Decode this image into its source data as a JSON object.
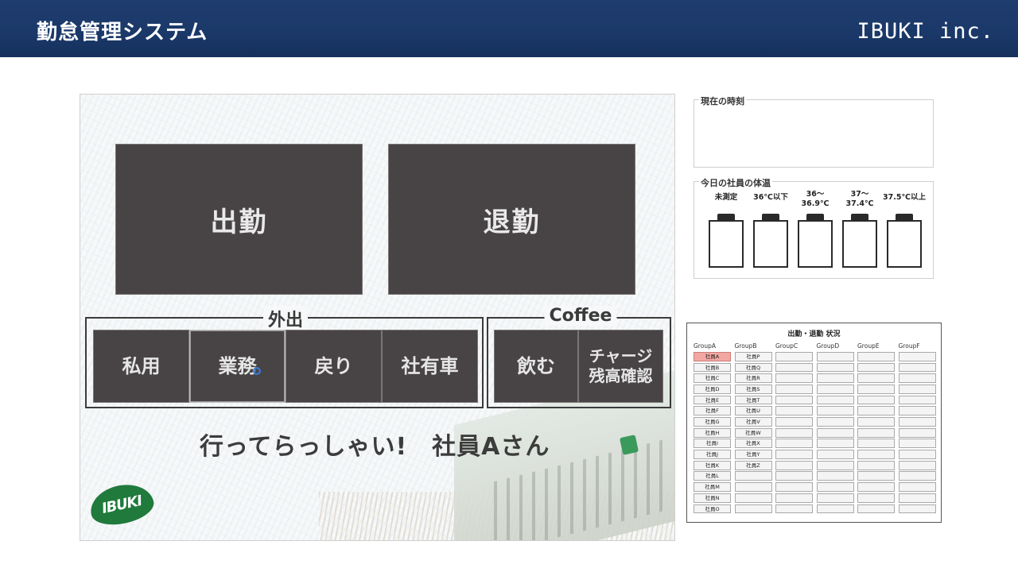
{
  "header": {
    "title": "勤怠管理システム",
    "company": "IBUKI inc."
  },
  "kiosk": {
    "clock_in_label": "出勤",
    "clock_out_label": "退勤",
    "outing": {
      "title": "外出",
      "buttons": [
        "私用",
        "業務",
        "戻り",
        "社有車"
      ]
    },
    "coffee": {
      "title": "Coffee",
      "drink_label": "飲む",
      "charge_label_line1": "チャージ",
      "charge_label_line2": "残高確認"
    },
    "greeting": "行ってらっしゃい!　社員Aさん",
    "logo_text": "IBUKI"
  },
  "time_panel": {
    "title": "現在の時刻",
    "value": ""
  },
  "temperature_panel": {
    "title": "今日の社員の体温",
    "categories": [
      {
        "line1": "未測定",
        "line2": ""
      },
      {
        "line1": "36℃以下",
        "line2": ""
      },
      {
        "line1": "36～",
        "line2": "36.9℃"
      },
      {
        "line1": "37～",
        "line2": "37.4℃"
      },
      {
        "line1": "37.5℃以上",
        "line2": ""
      }
    ]
  },
  "status_panel": {
    "title": "出勤・退勤  状況",
    "highlight_color": "#f2a7a3",
    "groups": [
      {
        "name": "GroupA",
        "cells": [
          "社員A",
          "社員B",
          "社員C",
          "社員D",
          "社員E",
          "社員F",
          "社員G",
          "社員H",
          "社員I",
          "社員J",
          "社員K",
          "社員L",
          "社員M",
          "社員N",
          "社員O"
        ]
      },
      {
        "name": "GroupB",
        "cells": [
          "社員P",
          "社員Q",
          "社員R",
          "社員S",
          "社員T",
          "社員U",
          "社員V",
          "社員W",
          "社員X",
          "社員Y",
          "社員Z",
          "",
          "",
          "",
          ""
        ]
      },
      {
        "name": "GroupC",
        "cells": [
          "",
          "",
          "",
          "",
          "",
          "",
          "",
          "",
          "",
          "",
          "",
          "",
          "",
          "",
          ""
        ]
      },
      {
        "name": "GroupD",
        "cells": [
          "",
          "",
          "",
          "",
          "",
          "",
          "",
          "",
          "",
          "",
          "",
          "",
          "",
          "",
          ""
        ]
      },
      {
        "name": "GroupE",
        "cells": [
          "",
          "",
          "",
          "",
          "",
          "",
          "",
          "",
          "",
          "",
          "",
          "",
          "",
          "",
          ""
        ]
      },
      {
        "name": "GroupF",
        "cells": [
          "",
          "",
          "",
          "",
          "",
          "",
          "",
          "",
          "",
          "",
          "",
          "",
          "",
          "",
          ""
        ]
      }
    ]
  }
}
